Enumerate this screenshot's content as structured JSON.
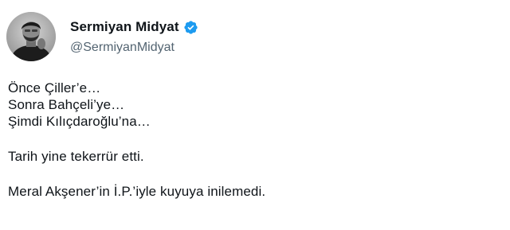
{
  "author": {
    "display_name": "Sermiyan Midyat",
    "handle": "@SermiyanMidyat",
    "verified": true,
    "verified_color": "#1d9bf0"
  },
  "tweet": {
    "lines": [
      "Önce Çiller’e…",
      "Sonra Bahçeli’ye…",
      "Şimdi Kılıçdaroğlu’na…",
      "",
      "Tarih yine tekerrür etti.",
      "",
      "Meral Akşener’in İ.P.’iyle kuyuya inilemedi."
    ]
  },
  "colors": {
    "text": "#0f1419",
    "secondary": "#536471",
    "background": "#ffffff"
  }
}
